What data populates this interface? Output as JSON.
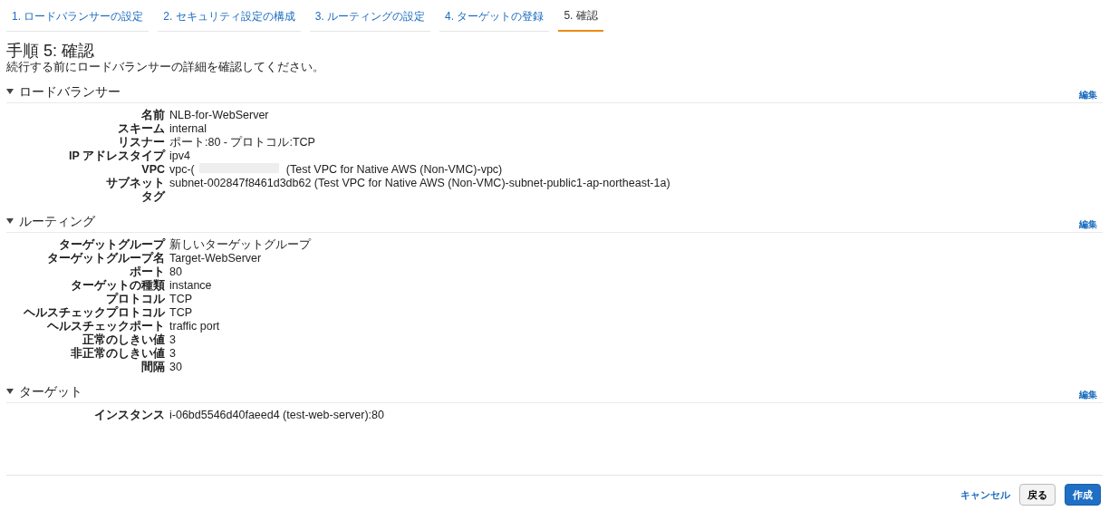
{
  "steps": [
    {
      "label": "1. ロードバランサーの設定",
      "selected": false
    },
    {
      "label": "2. セキュリティ設定の構成",
      "selected": false
    },
    {
      "label": "3. ルーティングの設定",
      "selected": false
    },
    {
      "label": "4. ターゲットの登録",
      "selected": false
    },
    {
      "label": "5. 確認",
      "selected": true
    }
  ],
  "title": "手順 5: 確認",
  "subtitle": "続行する前にロードバランサーの詳細を確認してください。",
  "sections": [
    {
      "title": "ロードバランサー",
      "expanded": true,
      "edit": "編集",
      "rows": [
        {
          "label": "名前",
          "value": "NLB-for-WebServer"
        },
        {
          "label": "スキーム",
          "value": "internal"
        },
        {
          "label": "リスナー",
          "value": "ポート:80 - プロトコル:TCP"
        },
        {
          "label": "IP アドレスタイプ",
          "value": "ipv4"
        },
        {
          "label": "VPC",
          "value": "vpc-(",
          "redacted": true,
          "suffix": "(Test VPC for Native AWS (Non-VMC)-vpc)"
        },
        {
          "label": "サブネット",
          "value": "subnet-002847f8461d3db62 (Test VPC for Native AWS (Non-VMC)-subnet-public1-ap-northeast-1a)"
        },
        {
          "label": "タグ"
        }
      ]
    },
    {
      "title": "ルーティング",
      "expanded": true,
      "edit": "編集",
      "rows": [
        {
          "label": "ターゲットグループ",
          "value": "新しいターゲットグループ"
        },
        {
          "label": "ターゲットグループ名",
          "value": "Target-WebServer"
        },
        {
          "label": "ポート",
          "value": "80"
        },
        {
          "label": "ターゲットの種類",
          "value": "instance"
        },
        {
          "label": "プロトコル",
          "value": "TCP"
        },
        {
          "label": "ヘルスチェックプロトコル",
          "value": "TCP"
        },
        {
          "label": "ヘルスチェックポート",
          "value": "traffic port"
        },
        {
          "label": "正常のしきい値",
          "value": "3"
        },
        {
          "label": "非正常のしきい値",
          "value": "3"
        },
        {
          "label": "間隔",
          "value": "30"
        }
      ]
    },
    {
      "title": "ターゲット",
      "expanded": true,
      "edit": "編集",
      "rows": [
        {
          "label": "インスタンス",
          "value": "i-06bd5546d40faeed4 (test-web-server):80"
        }
      ]
    }
  ],
  "footer": {
    "cancel": "キャンセル",
    "back": "戻る",
    "create": "作成"
  }
}
